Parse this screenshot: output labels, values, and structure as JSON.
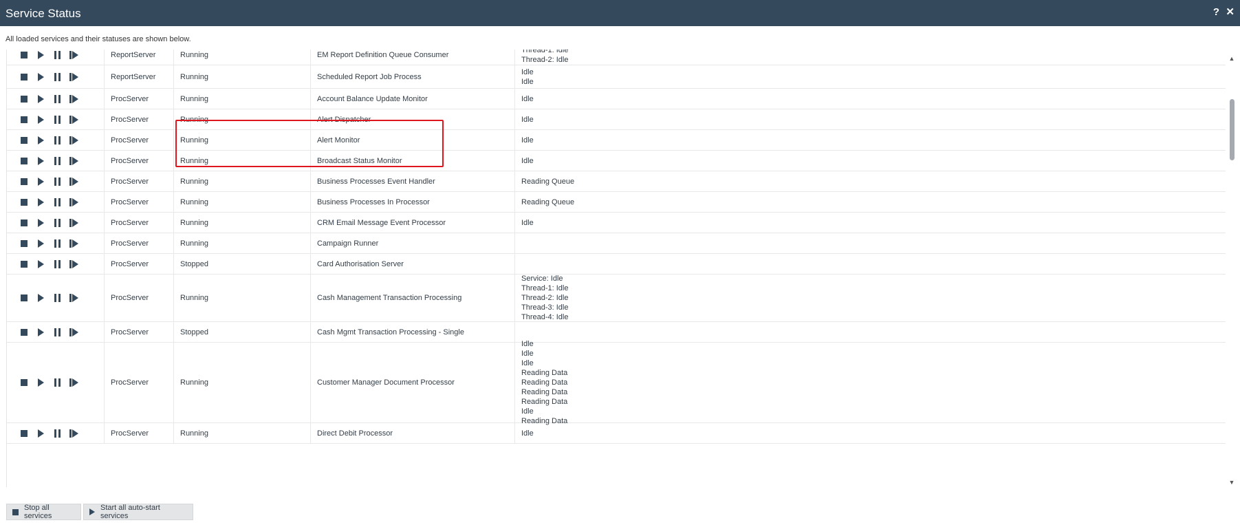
{
  "window": {
    "title": "Service Status",
    "help_label": "?",
    "close_label": "✕"
  },
  "description": "All loaded services and their statuses are shown below.",
  "icons": {
    "row_actions": [
      "stop-icon",
      "play-icon",
      "pause-icon",
      "step-icon"
    ],
    "scroll_up": "scroll-up-arrow-icon",
    "scroll_down": "scroll-down-arrow-icon"
  },
  "scroll": {
    "up_glyph": "▲",
    "down_glyph": "▼"
  },
  "colors": {
    "header": "#34495c",
    "highlight": "#e0161e",
    "text": "#333d47"
  },
  "rows": [
    {
      "server": "ReportServer",
      "status": "Running",
      "name": "EM Report Definition Queue Consumer",
      "details": [
        "Thread-1: Idle",
        "Thread-2: Idle"
      ]
    },
    {
      "server": "ReportServer",
      "status": "Running",
      "name": "Scheduled Report Job Process",
      "details": [
        "Idle",
        "Idle"
      ]
    },
    {
      "server": "ProcServer",
      "status": "Running",
      "name": "Account Balance Update Monitor",
      "details": [
        "Idle"
      ]
    },
    {
      "server": "ProcServer",
      "status": "Running",
      "name": "Alert Dispatcher",
      "details": [
        "Idle"
      ]
    },
    {
      "server": "ProcServer",
      "status": "Running",
      "name": "Alert Monitor",
      "details": [
        "Idle"
      ]
    },
    {
      "server": "ProcServer",
      "status": "Running",
      "name": "Broadcast Status Monitor",
      "details": [
        "Idle"
      ]
    },
    {
      "server": "ProcServer",
      "status": "Running",
      "name": "Business Processes Event Handler",
      "details": [
        "Reading Queue"
      ]
    },
    {
      "server": "ProcServer",
      "status": "Running",
      "name": "Business Processes In Processor",
      "details": [
        "Reading Queue"
      ]
    },
    {
      "server": "ProcServer",
      "status": "Running",
      "name": "CRM Email Message Event Processor",
      "details": [
        "Idle"
      ]
    },
    {
      "server": "ProcServer",
      "status": "Running",
      "name": "Campaign Runner",
      "details": []
    },
    {
      "server": "ProcServer",
      "status": "Stopped",
      "name": "Card Authorisation Server",
      "details": []
    },
    {
      "server": "ProcServer",
      "status": "Running",
      "name": "Cash Management Transaction Processing",
      "details": [
        "Service: Idle",
        "Thread-1: Idle",
        "Thread-2: Idle",
        "Thread-3: Idle",
        "Thread-4: Idle"
      ]
    },
    {
      "server": "ProcServer",
      "status": "Stopped",
      "name": "Cash Mgmt Transaction Processing - Single",
      "details": []
    },
    {
      "server": "ProcServer",
      "status": "Running",
      "name": "Customer Manager Document Processor",
      "details": [
        "Idle",
        "Idle",
        "Idle",
        "Reading Data",
        "Reading Data",
        "Reading Data",
        "Reading Data",
        "Idle",
        "Reading Data"
      ]
    },
    {
      "server": "ProcServer",
      "status": "Running",
      "name": "Direct Debit Processor",
      "details": [
        "Idle"
      ]
    }
  ],
  "footer": {
    "stop_all_label": "Stop all services",
    "start_all_label": "Start all auto-start services"
  }
}
